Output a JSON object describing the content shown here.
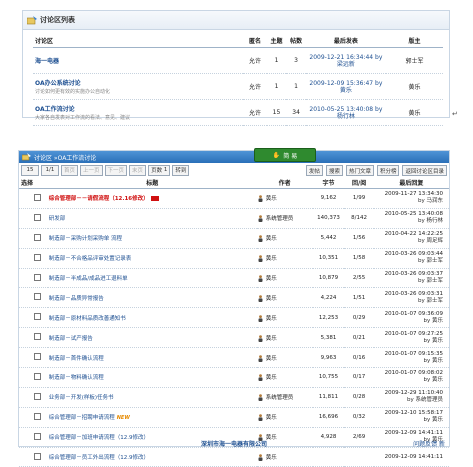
{
  "panel1": {
    "title": "讨论区列表",
    "headers": [
      "讨论区",
      "匿名",
      "主题",
      "帖数",
      "最后发表",
      "版主"
    ],
    "forums": [
      {
        "name": "海一电器",
        "desc": "",
        "anon": "允许",
        "topics": "1",
        "posts": "3",
        "last_time": "2009-12-21 16:34:44 by",
        "last_user": "梁远新",
        "mod": "郭士军"
      },
      {
        "name": "OA办公系统讨论",
        "desc": "讨论如何更有效的实施办公自动化",
        "anon": "允许",
        "topics": "1",
        "posts": "1",
        "last_time": "2009-12-09 15:36:47 by",
        "last_user": "黄乐",
        "mod": "黄乐"
      },
      {
        "name": "OA工作流讨论",
        "desc": "大家各自发表对工作流的看法、意见、建议",
        "anon": "允许",
        "topics": "15",
        "posts": "34",
        "last_time": "2010-05-25 13:40:08 by",
        "last_user": "杨行林",
        "mod": "黄乐"
      }
    ]
  },
  "panel2": {
    "breadcrumb": "讨论区 »OA工作流讨论",
    "search_label": "简 易",
    "page_size": "15",
    "page_index": "1/1",
    "nav": {
      "first": "首页",
      "prev": "上一页",
      "next": "下一页",
      "last": "末页",
      "page_no": "页数",
      "page_value": "1",
      "goto": "转到"
    },
    "actions": [
      "发帖",
      "搜索",
      "热门文章",
      "积分榜",
      "返回讨论区目录"
    ],
    "headers": [
      "选择",
      "标题",
      "作者",
      "字节",
      "回/阅",
      "最后回复"
    ],
    "threads": [
      {
        "title": "综合管理部－－请假流程（12.16修改）",
        "style": "red",
        "badge": "hot",
        "author": "黄乐",
        "bytes": "9,162",
        "rv": "1/99",
        "last_time": "2009-11-27 13:34:30",
        "last_by": "by 马润东"
      },
      {
        "title": "研发部",
        "style": "",
        "badge": "",
        "author": "系统管理员",
        "bytes": "140,373",
        "rv": "8/142",
        "last_time": "2010-05-25 13:40:08",
        "last_by": "by 杨行林"
      },
      {
        "title": "制造部－采购计划采购单 流程",
        "style": "",
        "badge": "",
        "author": "黄乐",
        "bytes": "5,442",
        "rv": "1/56",
        "last_time": "2010-04-22 14:22:25",
        "last_by": "by 周足辉"
      },
      {
        "title": "制造部－不合格品评审处置记录表",
        "style": "",
        "badge": "",
        "author": "黄乐",
        "bytes": "10,351",
        "rv": "1/58",
        "last_time": "2010-03-26 09:03:44",
        "last_by": "by 郭士军"
      },
      {
        "title": "制造部－半成品/成品进工退料单",
        "style": "",
        "badge": "",
        "author": "黄乐",
        "bytes": "10,879",
        "rv": "2/55",
        "last_time": "2010-03-26 09:03:37",
        "last_by": "by 郭士军"
      },
      {
        "title": "制造部－品质异常报告",
        "style": "",
        "badge": "",
        "author": "黄乐",
        "bytes": "4,224",
        "rv": "1/51",
        "last_time": "2010-03-26 09:03:31",
        "last_by": "by 郭士军"
      },
      {
        "title": "制造部－原材料品质改善通知书",
        "style": "",
        "badge": "",
        "author": "黄乐",
        "bytes": "12,253",
        "rv": "0/29",
        "last_time": "2010-01-07 09:36:09",
        "last_by": "by 黄乐"
      },
      {
        "title": "制造部－试产报告",
        "style": "",
        "badge": "",
        "author": "黄乐",
        "bytes": "5,381",
        "rv": "0/21",
        "last_time": "2010-01-07 09:27:25",
        "last_by": "by 黄乐"
      },
      {
        "title": "制造部－首件确认流程",
        "style": "",
        "badge": "",
        "author": "黄乐",
        "bytes": "9,963",
        "rv": "0/16",
        "last_time": "2010-01-07 09:15:35",
        "last_by": "by 黄乐"
      },
      {
        "title": "制造部－物料确认流程",
        "style": "",
        "badge": "",
        "author": "黄乐",
        "bytes": "10,755",
        "rv": "0/17",
        "last_time": "2010-01-07 09:08:02",
        "last_by": "by 黄乐"
      },
      {
        "title": "业务部－开发(样板)任务书",
        "style": "",
        "badge": "",
        "author": "系统管理员",
        "bytes": "11,811",
        "rv": "0/28",
        "last_time": "2009-12-29 11:10:40",
        "last_by": "by 系统管理员"
      },
      {
        "title": "综合管理部－招聘申请流程",
        "style": "",
        "badge": "new",
        "author": "黄乐",
        "bytes": "16,696",
        "rv": "0/32",
        "last_time": "2009-12-10 15:58:17",
        "last_by": "by 黄乐"
      },
      {
        "title": "综合管理部－加班申请流程（12.9修改）",
        "style": "",
        "badge": "",
        "author": "黄乐",
        "bytes": "4,928",
        "rv": "2/69",
        "last_time": "2009-12-09 14:41:11",
        "last_by": "by 黄乐"
      },
      {
        "title": "综合管理部－员工外出流程（12.9修改）",
        "style": "",
        "badge": "",
        "author": "黄乐",
        "bytes": "",
        "rv": "",
        "last_time": "2009-12-09 14:41:11",
        "last_by": ""
      }
    ],
    "new_badge": "NEW",
    "footer_company": "深圳市海一电器有限公司",
    "footer_links": "问题反馈  新"
  },
  "colors": {
    "header_blue": "#2a6fb8",
    "link_blue": "#1d4f91",
    "red_title": "#d01010",
    "green_button": "#2f8a2f"
  }
}
